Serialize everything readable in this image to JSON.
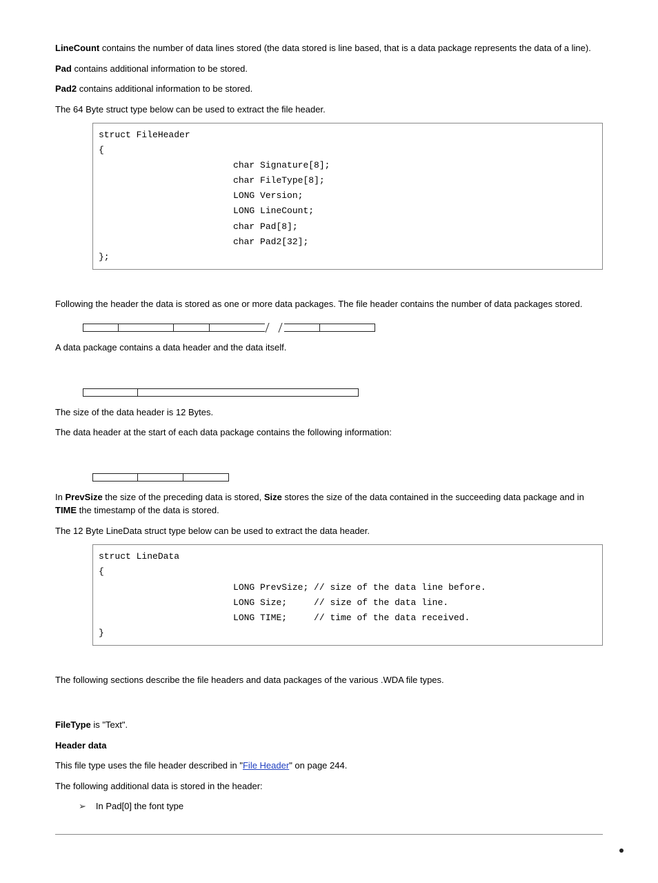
{
  "para_linecount_pre": "LineCount",
  "para_linecount_post": " contains the number of data lines stored (the data stored is line based, that is a data package represents the data of a line).",
  "para_pad_pre": "Pad",
  "para_pad_post": " contains additional information to be stored.",
  "para_pad2_pre": "Pad2",
  "para_pad2_post": " contains additional information to be stored.",
  "para_64byte": "The 64 Byte struct type below can be used to extract the file header.",
  "code1": "struct FileHeader\n{\n                         char Signature[8];\n                         char FileType[8];\n                         LONG Version;\n                         LONG LineCount;\n                         char Pad[8];\n                         char Pad2[32];\n};",
  "para_following_header": "Following the header the data is stored as one or more data packages. The file header contains the number of data packages stored.",
  "para_data_package": " A data package contains a data header and the data itself.",
  "para_size12": "The size of the data header is 12 Bytes.",
  "para_data_header_contains": "The data header at the start of each data package contains the following information:",
  "para_prev_1": "In ",
  "para_prev_2": "PrevSize",
  "para_prev_3": " the size of the preceding data is stored, ",
  "para_prev_4": "Size",
  "para_prev_5": " stores the size of the data contained in the succeeding data package and in ",
  "para_prev_6": "TIME",
  "para_prev_7": " the timestamp of the data is stored.",
  "para_12byte": "The 12 Byte LineData struct type below can be used to extract the data header.",
  "code2": "struct LineData\n{\n                         LONG PrevSize; // size of the data line before.\n                         LONG Size;     // size of the data line.\n                         LONG TIME;     // time of the data received.\n}",
  "para_following_sections": "The following sections describe the file headers and data packages of the various .WDA file types.",
  "filetype_pre": "FileType",
  "filetype_post": " is \"Text\".",
  "header_data": "Header data",
  "para_this_file_pre": "This file type uses the file header described in \"",
  "link_text": "File Header",
  "para_this_file_post": "\" on page 244.",
  "para_additional": "The following additional data is stored in the header:",
  "bullet1": "In Pad[0] the font type"
}
